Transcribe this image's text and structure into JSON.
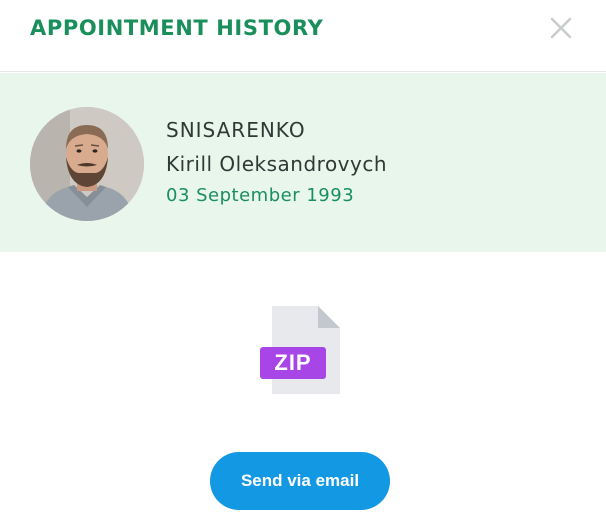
{
  "modal": {
    "title": "APPOINTMENT HISTORY",
    "close_icon": "close-icon"
  },
  "patient": {
    "avatar_icon": "avatar",
    "surname": "SNISARENKO",
    "given_names": "Kirill Oleksandrovych",
    "date_of_birth": "03 September 1993"
  },
  "attachment": {
    "icon": "zip-file-icon",
    "type_label": "ZIP"
  },
  "actions": {
    "send_label": "Send via email"
  },
  "colors": {
    "accent_green": "#1a8f5c",
    "patient_bg": "#e9f6ec",
    "button_blue": "#1398e3",
    "zip_purple": "#a745e6"
  }
}
